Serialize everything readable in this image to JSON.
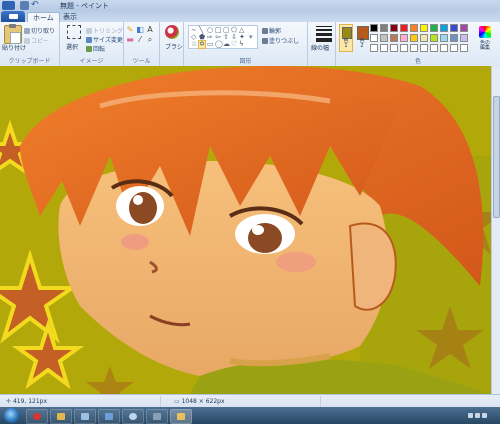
{
  "window": {
    "title": "無題 - ペイント"
  },
  "tabs": [
    {
      "label": "ホーム"
    },
    {
      "label": "表示"
    }
  ],
  "clipboard": {
    "paste_label": "貼り付け",
    "cut_label": "切り取り",
    "copy_label": "コピー",
    "group_label": "クリップボード"
  },
  "image": {
    "select_label": "選択",
    "crop_label": "トリミング",
    "resize_label": "サイズ変更",
    "rotate_label": "回転",
    "group_label": "イメージ"
  },
  "tools": {
    "group_label": "ツール",
    "brush_label": "ブラシ"
  },
  "shapes": {
    "outline_label": "輪郭",
    "fill_label": "塗りつぶし",
    "group_label": "図形"
  },
  "stroke": {
    "label": "線の幅"
  },
  "colors": {
    "color1_label": "色\n1",
    "color2_label": "色\n2",
    "edit_label": "色の\n編集",
    "group_label": "色",
    "color1": "#9a8a12",
    "color2": "#b85a1c",
    "palette": [
      "#000000",
      "#7f7f7f",
      "#880015",
      "#ed1c24",
      "#ff7f27",
      "#fff200",
      "#22b14c",
      "#00a2e8",
      "#3f48cc",
      "#a349a4",
      "#ffffff",
      "#c3c3c3",
      "#b97a57",
      "#ffaec9",
      "#ffc90e",
      "#efe4b0",
      "#b5e61d",
      "#99d9ea",
      "#7092be",
      "#c8bfe7",
      "#ffffff",
      "#ffffff",
      "#ffffff",
      "#ffffff",
      "#ffffff",
      "#ffffff",
      "#ffffff",
      "#ffffff",
      "#ffffff",
      "#ffffff"
    ]
  },
  "status": {
    "cursor_position": "419, 121px",
    "image_size": "1048 × 622px"
  }
}
